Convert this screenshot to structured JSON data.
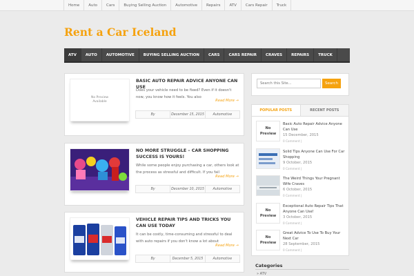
{
  "topnav": [
    "Home",
    "Auto",
    "Cars",
    "Buying Selling Auction",
    "Automotive",
    "Repairs",
    "ATV",
    "Cars Repair",
    "Truck"
  ],
  "site_title": "Rent a Car Iceland",
  "mainnav": [
    "ATV",
    "AUTO",
    "AUTOMOTIVE",
    "BUYING SELLING AUCTION",
    "CARS",
    "CARS REPAIR",
    "CRAVES",
    "REPAIRS",
    "TRUCK"
  ],
  "posts": [
    {
      "title": "BASIC AUTO REPAIR ADVICE ANYONE CAN USE",
      "excerpt": "Does your vehicle need to be fixed? Even if it doesn't now, you know how it feels. You also",
      "read_more": "Read More →",
      "by": "By",
      "date": "December 15, 2015",
      "category": "Automotive",
      "thumb_text": "No Preview Available"
    },
    {
      "title": "NO MORE STRUGGLE – CAR SHOPPING SUCCESS IS YOURS!",
      "excerpt": "While some people enjoy purchasing a car, others look at the process as stressful and difficult. If you fail",
      "read_more": "Read More →",
      "by": "By",
      "date": "December 10, 2015",
      "category": "Automotive"
    },
    {
      "title": "VEHICLE REPAIR TIPS AND TRICKS YOU CAN USE TODAY",
      "excerpt": "It can be costly, time-consuming and stressful to deal with auto repairs if you don't know a lot about",
      "read_more": "Read More →",
      "by": "By",
      "date": "December 5, 2015",
      "category": "Automotive"
    }
  ],
  "search": {
    "placeholder": "Search this Site...",
    "button": "Search"
  },
  "tabs": {
    "popular": "POPULAR POSTS",
    "recent": "RECENT POSTS"
  },
  "sidebar_posts": [
    {
      "title": "Basic Auto Repair Advice Anyone Can Use",
      "date": "15 December, 2015",
      "comments": "0 Comment |",
      "thumb_text": "No Preview"
    },
    {
      "title": "Solid Tips Anyone Can Use For Car Shopping",
      "date": "9 October, 2015",
      "comments": "0 Comment |"
    },
    {
      "title": "The Weird Things Your Pregnant Wife Craves",
      "date": "6 October, 2015",
      "comments": "0 Comment |"
    },
    {
      "title": "Exceptional Auto Repair Tips That Anyone Can Use!",
      "date": "3 October, 2015",
      "comments": "0 Comment |",
      "thumb_text": "No Preview"
    },
    {
      "title": "Great Advice To Use To Buy Your Next Car",
      "date": "28 September, 2015",
      "comments": "0 Comment |",
      "thumb_text": "No Preview"
    }
  ],
  "categories": {
    "heading": "Categories",
    "first": "ATV"
  }
}
